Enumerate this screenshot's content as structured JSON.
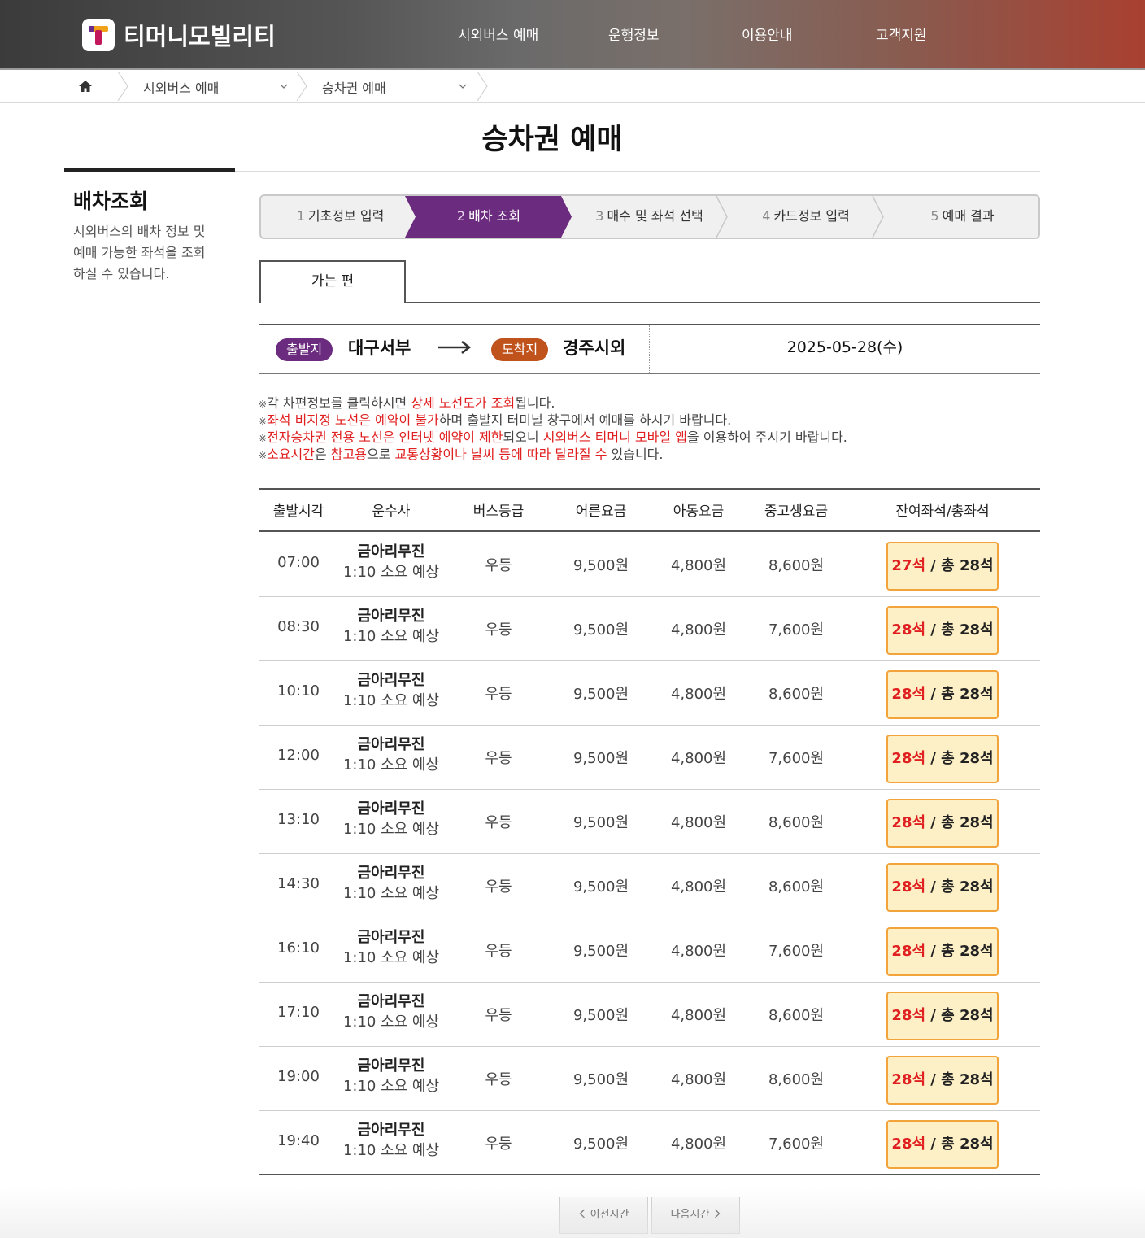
{
  "header": {
    "logo_text": "티머니모빌리티",
    "nav": [
      "시외버스 예매",
      "운행정보",
      "이용안내",
      "고객지원"
    ]
  },
  "breadcrumb": {
    "home_icon": "home-icon",
    "items": [
      "시외버스 예매",
      "승차권 예매"
    ]
  },
  "page_title": "승차권 예매",
  "sidebar": {
    "title": "배차조회",
    "desc_lines": [
      "시외버스의 배차 정보 및",
      "예매 가능한 좌석을 조회",
      "하실 수 있습니다."
    ]
  },
  "steps": [
    {
      "num": "1",
      "label": "기초정보 입력"
    },
    {
      "num": "2",
      "label": "배차 조회"
    },
    {
      "num": "3",
      "label": "매수 및 좌석 선택"
    },
    {
      "num": "4",
      "label": "카드정보 입력"
    },
    {
      "num": "5",
      "label": "예매 결과"
    }
  ],
  "tab_label": "가는 편",
  "route": {
    "dep_badge": "출발지",
    "dep_city": "대구서부",
    "arr_badge": "도착지",
    "arr_city": "경주시외",
    "date": "2025-05-28(수)"
  },
  "notes": {
    "mark": "※",
    "l1": [
      "각 차편정보를 클릭하시면 ",
      "상세 노선도가 조회",
      "됩니다."
    ],
    "l2": [
      "좌석 비지정 노선은 예약이 불가",
      "하며 출발지 터미널 창구에서 예매를 하시기 바랍니다."
    ],
    "l3": [
      "전자승차권 전용 노선은 인터넷 예약이 제한",
      "되오니 ",
      "시외버스 티머니 모바일 앱",
      "을 이용하여 주시기 바랍니다."
    ],
    "l4": [
      "소요시간",
      "은 ",
      "참고용",
      "으로 ",
      "교통상황이나 날씨 등에 따라 달라질 수",
      " 있습니다."
    ]
  },
  "table": {
    "headers": [
      "출발시각",
      "운수사",
      "버스등급",
      "어른요금",
      "아동요금",
      "중고생요금",
      "잔여좌석/총좌석"
    ],
    "rows": [
      {
        "time": "07:00",
        "carrier": "금아리무진",
        "duration": "1:10 소요 예상",
        "grade": "우등",
        "adult": "9,500원",
        "child": "4,800원",
        "youth": "8,600원",
        "remain": "27석",
        "total": " / 총 28석"
      },
      {
        "time": "08:30",
        "carrier": "금아리무진",
        "duration": "1:10 소요 예상",
        "grade": "우등",
        "adult": "9,500원",
        "child": "4,800원",
        "youth": "7,600원",
        "remain": "28석",
        "total": " / 총 28석"
      },
      {
        "time": "10:10",
        "carrier": "금아리무진",
        "duration": "1:10 소요 예상",
        "grade": "우등",
        "adult": "9,500원",
        "child": "4,800원",
        "youth": "8,600원",
        "remain": "28석",
        "total": " / 총 28석"
      },
      {
        "time": "12:00",
        "carrier": "금아리무진",
        "duration": "1:10 소요 예상",
        "grade": "우등",
        "adult": "9,500원",
        "child": "4,800원",
        "youth": "7,600원",
        "remain": "28석",
        "total": " / 총 28석"
      },
      {
        "time": "13:10",
        "carrier": "금아리무진",
        "duration": "1:10 소요 예상",
        "grade": "우등",
        "adult": "9,500원",
        "child": "4,800원",
        "youth": "8,600원",
        "remain": "28석",
        "total": " / 총 28석"
      },
      {
        "time": "14:30",
        "carrier": "금아리무진",
        "duration": "1:10 소요 예상",
        "grade": "우등",
        "adult": "9,500원",
        "child": "4,800원",
        "youth": "8,600원",
        "remain": "28석",
        "total": " / 총 28석"
      },
      {
        "time": "16:10",
        "carrier": "금아리무진",
        "duration": "1:10 소요 예상",
        "grade": "우등",
        "adult": "9,500원",
        "child": "4,800원",
        "youth": "7,600원",
        "remain": "28석",
        "total": " / 총 28석"
      },
      {
        "time": "17:10",
        "carrier": "금아리무진",
        "duration": "1:10 소요 예상",
        "grade": "우등",
        "adult": "9,500원",
        "child": "4,800원",
        "youth": "8,600원",
        "remain": "28석",
        "total": " / 총 28석"
      },
      {
        "time": "19:00",
        "carrier": "금아리무진",
        "duration": "1:10 소요 예상",
        "grade": "우등",
        "adult": "9,500원",
        "child": "4,800원",
        "youth": "8,600원",
        "remain": "28석",
        "total": " / 총 28석"
      },
      {
        "time": "19:40",
        "carrier": "금아리무진",
        "duration": "1:10 소요 예상",
        "grade": "우등",
        "adult": "9,500원",
        "child": "4,800원",
        "youth": "7,600원",
        "remain": "28석",
        "total": " / 총 28석"
      }
    ]
  },
  "pager": {
    "prev": "이전시간",
    "next": "다음시간"
  },
  "colors": {
    "accent_purple": "#6b2b7e",
    "accent_orange": "#c0531c",
    "alert_red": "#e02020",
    "seat_bg": "#fdf0c6",
    "seat_border": "#f2a33a"
  }
}
